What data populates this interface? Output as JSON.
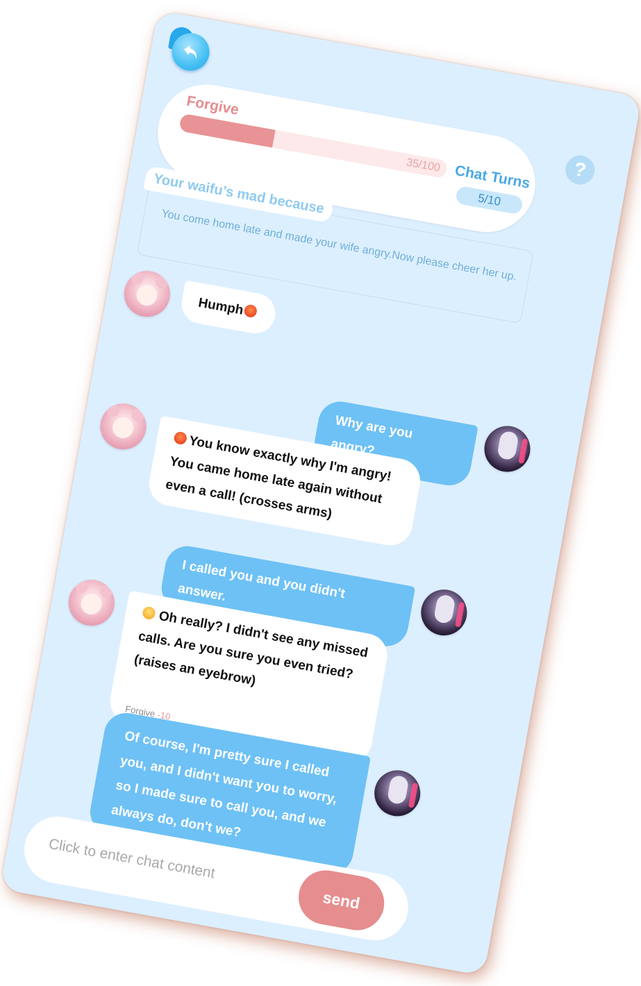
{
  "forgive": {
    "label": "Forgive",
    "value_text": "35/100",
    "value": 35,
    "max": 100,
    "bar_color": "#e89395",
    "track_color": "#fde9e9"
  },
  "chat_turns": {
    "label": "Chat Turns",
    "value_text": "5/10"
  },
  "help": {
    "icon": "question-mark-icon",
    "symbol": "?"
  },
  "back": {
    "icon": "back-arrow-icon"
  },
  "reason": {
    "tag": "Your waifu’s mad because",
    "text": "You come home late and made your wife angry.Now please cheer her up."
  },
  "messages": [
    {
      "from": "waifu",
      "emoji": "angry-face-icon",
      "text": "Humph"
    },
    {
      "from": "user",
      "text": "Why are you angry?"
    },
    {
      "from": "waifu",
      "emoji": "angry-face-icon",
      "text": "You know exactly why I'm angry! You came home late again without even a call! (crosses arms)"
    },
    {
      "from": "user",
      "text": "I called you and you didn't answer."
    },
    {
      "from": "waifu",
      "emoji": "annoyed-face-icon",
      "text": "Oh really? I didn't see any missed calls. Are you sure you even tried? (raises an eyebrow)",
      "note_label": "Forgive",
      "note_delta": "-10"
    },
    {
      "from": "user",
      "text": "Of course, I'm pretty sure I called you, and I didn't want you to worry, so I made sure to call you, and we always do, don't we?"
    }
  ],
  "input": {
    "placeholder": "Click to enter chat content",
    "send_label": "send"
  },
  "colors": {
    "background": "#dcefff",
    "accent_blue": "#6ec1f5",
    "accent_pink": "#e68d8f"
  }
}
